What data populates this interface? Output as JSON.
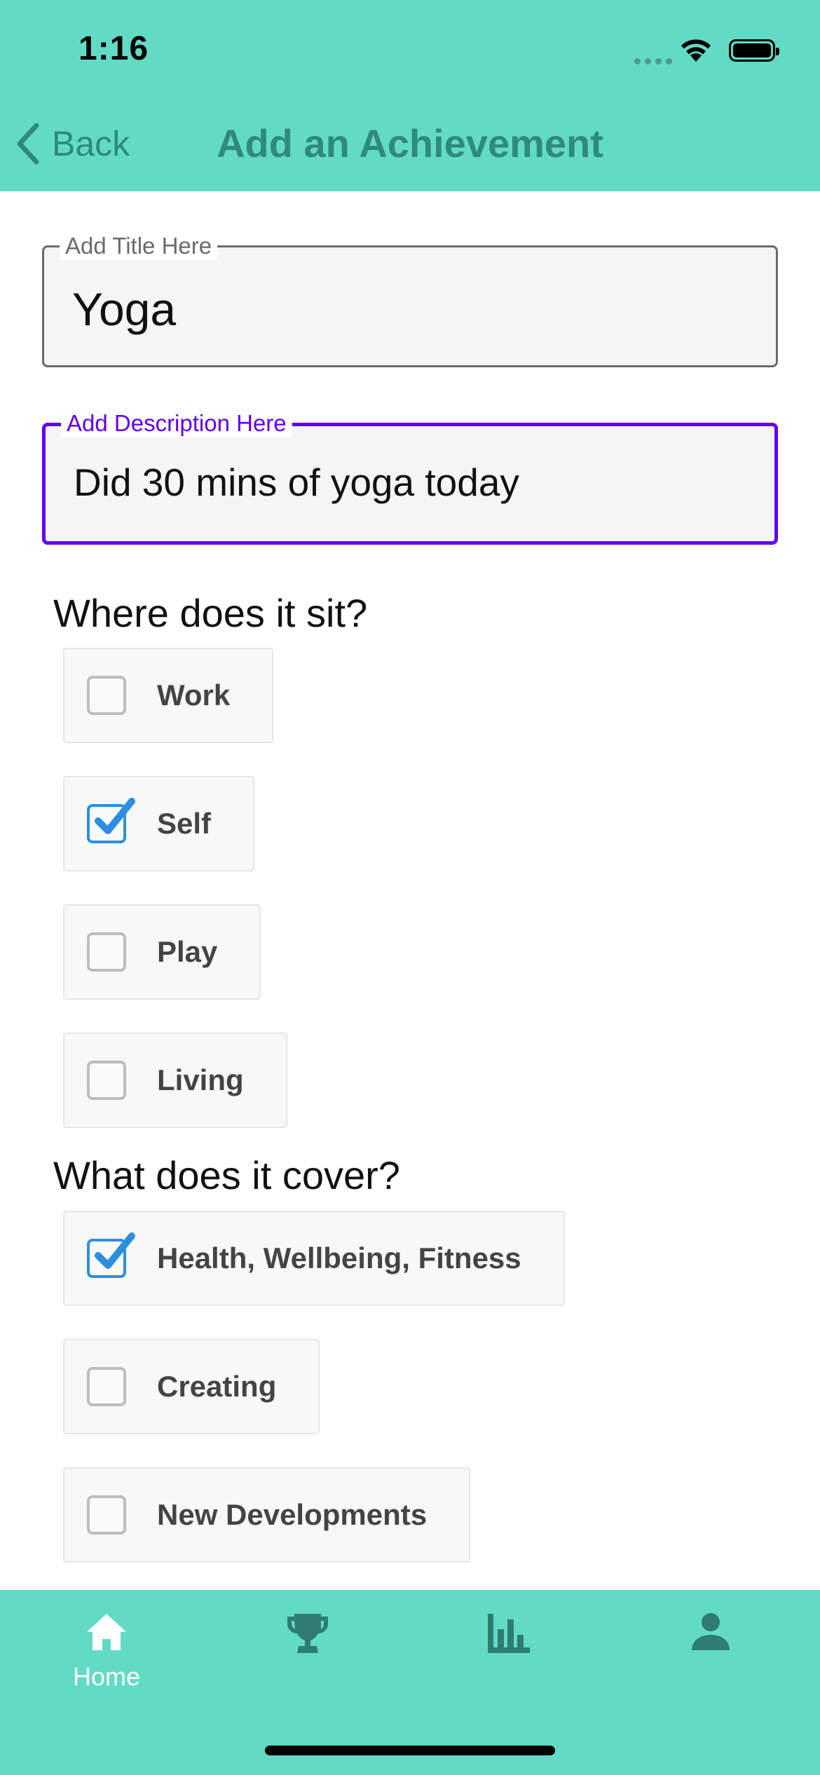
{
  "status_bar": {
    "time": "1:16"
  },
  "nav": {
    "back_label": "Back",
    "title": "Add an Achievement"
  },
  "form": {
    "title_field": {
      "label": "Add Title Here",
      "value": "Yoga"
    },
    "description_field": {
      "label": "Add Description Here",
      "value": "Did 30 mins of yoga today"
    }
  },
  "sections": {
    "where": {
      "heading": "Where does it sit?",
      "options": [
        {
          "label": "Work",
          "checked": false
        },
        {
          "label": "Self",
          "checked": true
        },
        {
          "label": "Play",
          "checked": false
        },
        {
          "label": "Living",
          "checked": false
        }
      ]
    },
    "cover": {
      "heading": "What does it cover?",
      "options": [
        {
          "label": "Health, Wellbeing, Fitness",
          "checked": true
        },
        {
          "label": "Creating",
          "checked": false
        },
        {
          "label": "New Developments",
          "checked": false
        }
      ]
    }
  },
  "tabbar": {
    "tabs": [
      {
        "icon": "home-icon",
        "label": "Home",
        "active": true
      },
      {
        "icon": "trophy-icon",
        "label": "",
        "active": false
      },
      {
        "icon": "bar-chart-icon",
        "label": "",
        "active": false
      },
      {
        "icon": "person-icon",
        "label": "",
        "active": false
      }
    ]
  },
  "colors": {
    "header_bg": "#62dbc5",
    "header_text": "#2e8a7c",
    "focus_accent": "#6200ee",
    "checkbox_checked": "#2d8ee0"
  }
}
